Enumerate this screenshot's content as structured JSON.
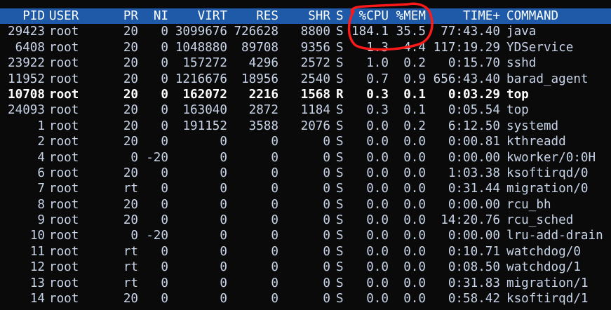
{
  "header": {
    "pid": "PID",
    "user": "USER",
    "pr": "PR",
    "ni": "NI",
    "virt": "VIRT",
    "res": "RES",
    "shr": "SHR",
    "s": "S",
    "cpu": "%CPU",
    "mem": "%MEM",
    "time": "TIME+",
    "command": "COMMAND"
  },
  "processes": [
    {
      "pid": "29423",
      "user": "root",
      "pr": "20",
      "ni": "0",
      "virt": "3099676",
      "res": "726628",
      "shr": "8800",
      "s": "S",
      "cpu": "184.1",
      "mem": "35.5",
      "time": "77:43.40",
      "command": "java"
    },
    {
      "pid": "6408",
      "user": "root",
      "pr": "20",
      "ni": "0",
      "virt": "1048880",
      "res": "89708",
      "shr": "9356",
      "s": "S",
      "cpu": "1.3",
      "mem": "4.4",
      "time": "117:19.29",
      "command": "YDService"
    },
    {
      "pid": "23922",
      "user": "root",
      "pr": "20",
      "ni": "0",
      "virt": "157272",
      "res": "4296",
      "shr": "2572",
      "s": "S",
      "cpu": "1.0",
      "mem": "0.2",
      "time": "0:15.70",
      "command": "sshd"
    },
    {
      "pid": "11952",
      "user": "root",
      "pr": "20",
      "ni": "0",
      "virt": "1216676",
      "res": "18956",
      "shr": "2540",
      "s": "S",
      "cpu": "0.7",
      "mem": "0.9",
      "time": "656:43.40",
      "command": "barad_agent"
    },
    {
      "pid": "10708",
      "user": "root",
      "pr": "20",
      "ni": "0",
      "virt": "162072",
      "res": "2216",
      "shr": "1568",
      "s": "R",
      "cpu": "0.3",
      "mem": "0.1",
      "time": "0:03.29",
      "command": "top"
    },
    {
      "pid": "24093",
      "user": "root",
      "pr": "20",
      "ni": "0",
      "virt": "163040",
      "res": "2872",
      "shr": "1184",
      "s": "S",
      "cpu": "0.3",
      "mem": "0.1",
      "time": "0:05.54",
      "command": "top"
    },
    {
      "pid": "1",
      "user": "root",
      "pr": "20",
      "ni": "0",
      "virt": "191152",
      "res": "3588",
      "shr": "2076",
      "s": "S",
      "cpu": "0.0",
      "mem": "0.2",
      "time": "6:12.50",
      "command": "systemd"
    },
    {
      "pid": "2",
      "user": "root",
      "pr": "20",
      "ni": "0",
      "virt": "0",
      "res": "0",
      "shr": "0",
      "s": "S",
      "cpu": "0.0",
      "mem": "0.0",
      "time": "0:00.81",
      "command": "kthreadd"
    },
    {
      "pid": "4",
      "user": "root",
      "pr": "0",
      "ni": "-20",
      "virt": "0",
      "res": "0",
      "shr": "0",
      "s": "S",
      "cpu": "0.0",
      "mem": "0.0",
      "time": "0:00.00",
      "command": "kworker/0:0H"
    },
    {
      "pid": "6",
      "user": "root",
      "pr": "20",
      "ni": "0",
      "virt": "0",
      "res": "0",
      "shr": "0",
      "s": "S",
      "cpu": "0.0",
      "mem": "0.0",
      "time": "1:03.38",
      "command": "ksoftirqd/0"
    },
    {
      "pid": "7",
      "user": "root",
      "pr": "rt",
      "ni": "0",
      "virt": "0",
      "res": "0",
      "shr": "0",
      "s": "S",
      "cpu": "0.0",
      "mem": "0.0",
      "time": "0:31.44",
      "command": "migration/0"
    },
    {
      "pid": "8",
      "user": "root",
      "pr": "20",
      "ni": "0",
      "virt": "0",
      "res": "0",
      "shr": "0",
      "s": "S",
      "cpu": "0.0",
      "mem": "0.0",
      "time": "0:00.00",
      "command": "rcu_bh"
    },
    {
      "pid": "9",
      "user": "root",
      "pr": "20",
      "ni": "0",
      "virt": "0",
      "res": "0",
      "shr": "0",
      "s": "S",
      "cpu": "0.0",
      "mem": "0.0",
      "time": "14:20.76",
      "command": "rcu_sched"
    },
    {
      "pid": "10",
      "user": "root",
      "pr": "0",
      "ni": "-20",
      "virt": "0",
      "res": "0",
      "shr": "0",
      "s": "S",
      "cpu": "0.0",
      "mem": "0.0",
      "time": "0:00.00",
      "command": "lru-add-drain"
    },
    {
      "pid": "11",
      "user": "root",
      "pr": "rt",
      "ni": "0",
      "virt": "0",
      "res": "0",
      "shr": "0",
      "s": "S",
      "cpu": "0.0",
      "mem": "0.0",
      "time": "0:10.71",
      "command": "watchdog/0"
    },
    {
      "pid": "12",
      "user": "root",
      "pr": "rt",
      "ni": "0",
      "virt": "0",
      "res": "0",
      "shr": "0",
      "s": "S",
      "cpu": "0.0",
      "mem": "0.0",
      "time": "0:08.50",
      "command": "watchdog/1"
    },
    {
      "pid": "13",
      "user": "root",
      "pr": "rt",
      "ni": "0",
      "virt": "0",
      "res": "0",
      "shr": "0",
      "s": "S",
      "cpu": "0.0",
      "mem": "0.0",
      "time": "0:31.83",
      "command": "migration/1"
    },
    {
      "pid": "14",
      "user": "root",
      "pr": "20",
      "ni": "0",
      "virt": "0",
      "res": "0",
      "shr": "0",
      "s": "S",
      "cpu": "0.0",
      "mem": "0.0",
      "time": "0:58.42",
      "command": "ksoftirqd/1"
    }
  ],
  "highlighted_row_index": 4,
  "colors": {
    "background": "#0a0a0a",
    "text": "#c8d4e8",
    "header_bg": "#1e5aa8",
    "annotation": "#ff1a1a"
  }
}
